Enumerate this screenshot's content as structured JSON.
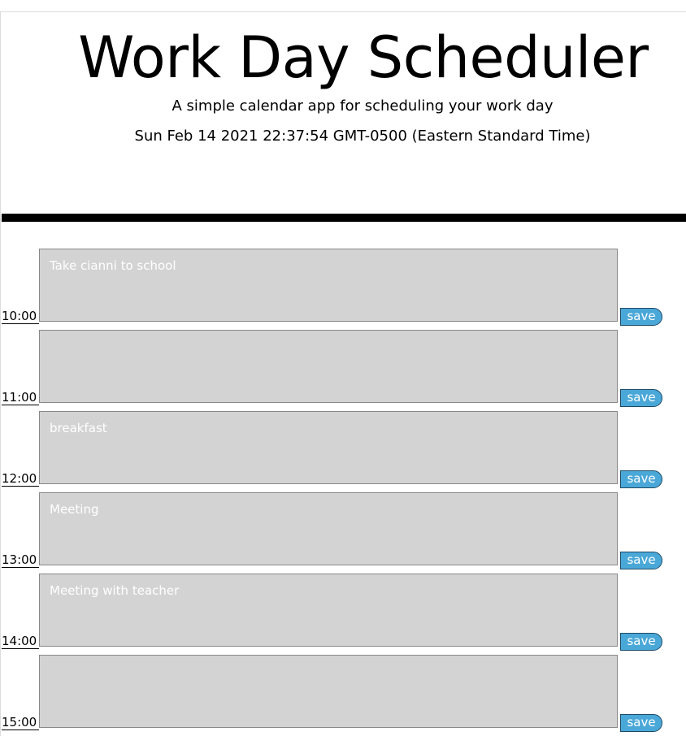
{
  "header": {
    "title": "Work Day Scheduler",
    "subtitle": "A simple calendar app for scheduling your work day",
    "current_date": "Sun Feb 14 2021 22:37:54 GMT-0500 (Eastern Standard Time)"
  },
  "colors": {
    "past_block": "#d3d3d3",
    "save_button": "#4aa8d8",
    "divider": "#000000"
  },
  "time_blocks": [
    {
      "hour": "10:00",
      "text": "Take cianni to school",
      "save_label": "save"
    },
    {
      "hour": "11:00",
      "text": "",
      "save_label": "save"
    },
    {
      "hour": "12:00",
      "text": "breakfast",
      "save_label": "save"
    },
    {
      "hour": "13:00",
      "text": "Meeting",
      "save_label": "save"
    },
    {
      "hour": "14:00",
      "text": "Meeting with teacher",
      "save_label": "save"
    },
    {
      "hour": "15:00",
      "text": "",
      "save_label": "save"
    }
  ]
}
